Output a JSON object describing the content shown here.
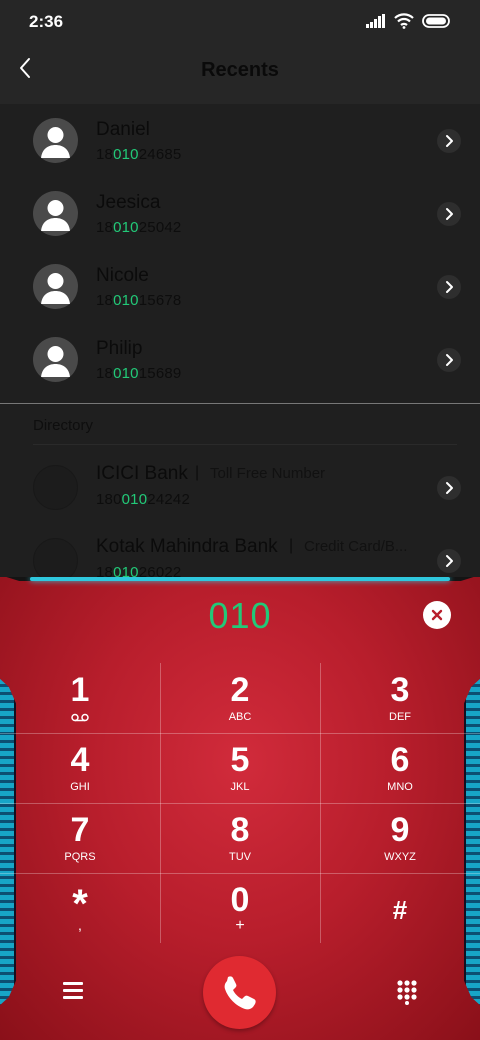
{
  "status": {
    "time": "2:36",
    "icons": [
      "signal-icon",
      "wifi-icon",
      "battery-icon"
    ]
  },
  "header": {
    "title": "Recents",
    "back_icon": "chevron-left-icon"
  },
  "recents": [
    {
      "name": "Daniel",
      "number_pre": "18",
      "number_match": "010",
      "number_post": "24685"
    },
    {
      "name": "Jeesica",
      "number_pre": "18",
      "number_match": "010",
      "number_post": "25042"
    },
    {
      "name": "Nicole",
      "number_pre": "18",
      "number_match": "010",
      "number_post": "15678"
    },
    {
      "name": "Philip",
      "number_pre": "18",
      "number_match": "010",
      "number_post": "15689"
    }
  ],
  "directory": {
    "label": "Directory",
    "items": [
      {
        "name": "ICICI Bank",
        "separator": "|",
        "tag": "Toll Free Number",
        "number_pre": "180",
        "number_match": "010",
        "number_post": "24242"
      },
      {
        "name": "Kotak Mahindra Bank",
        "separator": "|",
        "tag": "Credit Card/B...",
        "number_pre": "18",
        "number_match": "010",
        "number_post": "26022"
      }
    ]
  },
  "dialer": {
    "number": "010",
    "keys": [
      {
        "digit": "1",
        "letters": "voicemail-icon"
      },
      {
        "digit": "2",
        "letters": "ABC"
      },
      {
        "digit": "3",
        "letters": "DEF"
      },
      {
        "digit": "4",
        "letters": "GHI"
      },
      {
        "digit": "5",
        "letters": "JKL"
      },
      {
        "digit": "6",
        "letters": "MNO"
      },
      {
        "digit": "7",
        "letters": "PQRS"
      },
      {
        "digit": "8",
        "letters": "TUV"
      },
      {
        "digit": "9",
        "letters": "WXYZ"
      },
      {
        "digit": "*",
        "letters": ","
      },
      {
        "digit": "0",
        "letters": "+"
      },
      {
        "digit": "#",
        "letters": ""
      }
    ]
  },
  "colors": {
    "accent_green": "#22c978",
    "dialer_red": "#c8232f",
    "call_red": "#e02a31",
    "cyan": "#2fc7dd"
  }
}
